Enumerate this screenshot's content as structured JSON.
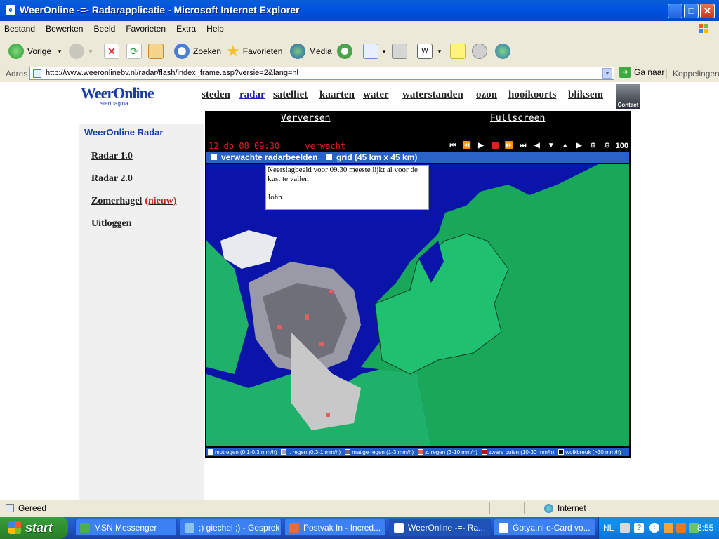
{
  "window": {
    "title": "WeerOnline -=- Radarapplicatie - Microsoft Internet Explorer",
    "buttons": [
      "_",
      "□",
      "✕"
    ]
  },
  "menu": [
    "Bestand",
    "Bewerken",
    "Beeld",
    "Favorieten",
    "Extra",
    "Help"
  ],
  "toolbar": {
    "back": "Vorige",
    "search": "Zoeken",
    "favorites": "Favorieten",
    "media": "Media"
  },
  "address": {
    "label": "Adres",
    "url": "http://www.weeronlinebv.nl/radar/flash/index_frame.asp?versie=2&lang=nl",
    "go": "Ga naar",
    "links": "Koppelingen"
  },
  "site": {
    "logo": "WeerOnline",
    "logo_sub": "startpagina",
    "nav": [
      "steden",
      "radar",
      "satelliet",
      "kaarten",
      "water",
      "waterstanden",
      "ozon",
      "hooikoorts",
      "bliksem"
    ],
    "nav_active": "radar",
    "contact": "Contact",
    "sidebar_title": "WeerOnline Radar",
    "sidebar_links": [
      "Radar 1.0",
      "Radar 2.0",
      "Zomerhagel",
      "Uitloggen"
    ],
    "new_badge": "(nieuw)"
  },
  "radar": {
    "refresh": "Verversen",
    "fullscreen": "Fullscreen",
    "datetime": "12 do 08 09:30",
    "mode": "verwacht",
    "zoom": "100",
    "opt_forecast": "verwachte radarbeelden",
    "opt_grid": "grid (45 km x 45 km)",
    "note_line1": "Neerslagbeeld voor 09.30 meeste lijkt al voor de kust te vallen",
    "note_line2": "John",
    "legend": [
      {
        "label": "motregen (0.1-0.3 mm/h)",
        "color": "#ffffff"
      },
      {
        "label": "l. regen (0.3-1 mm/h)",
        "color": "#a8a8a8"
      },
      {
        "label": "matige regen (1-3 mm/h)",
        "color": "#6b6b6b"
      },
      {
        "label": "z. regen (3-10 mm/h)",
        "color": "#e06060"
      },
      {
        "label": "zware buien (10-30 mm/h)",
        "color": "#b01818"
      },
      {
        "label": "wolkbreuk (>30 mm/h)",
        "color": "#111111"
      }
    ],
    "colors": {
      "sea": "#0a14a8",
      "land": "#1fb06a",
      "land_east": "#19a85a"
    }
  },
  "status": {
    "left": "Gereed",
    "zone": "Internet"
  },
  "taskbar": {
    "start": "start",
    "tasks": [
      {
        "label": "MSN Messenger"
      },
      {
        "label": ";) giechel ;) - Gesprek"
      },
      {
        "label": "Postvak In - Incred..."
      },
      {
        "label": "WeerOnline -=- Ra..."
      },
      {
        "label": "Gotya.nl e-Card vo..."
      }
    ],
    "lang": "NL",
    "clock": "8:55"
  }
}
